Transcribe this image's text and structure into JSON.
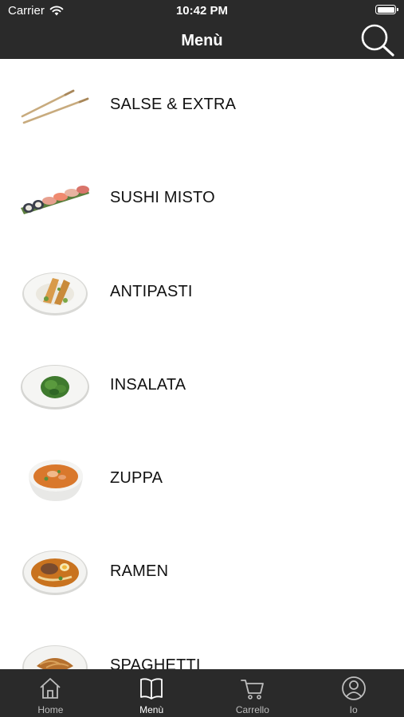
{
  "status_bar": {
    "carrier": "Carrier",
    "time": "10:42 PM"
  },
  "nav": {
    "title": "Menù",
    "search_icon": "search-icon"
  },
  "menu": {
    "items": [
      {
        "label": "SALSE & EXTRA",
        "image": "chopsticks"
      },
      {
        "label": "SUSHI MISTO",
        "image": "sushi-platter"
      },
      {
        "label": "ANTIPASTI",
        "image": "tempura-plate"
      },
      {
        "label": "INSALATA",
        "image": "seaweed-salad-bowl"
      },
      {
        "label": "ZUPPA",
        "image": "soup-bowl"
      },
      {
        "label": "RAMEN",
        "image": "ramen-bowl"
      },
      {
        "label": "SPAGHETTI",
        "image": "noodle-plate"
      }
    ]
  },
  "tabbar": {
    "tabs": [
      {
        "label": "Home",
        "icon": "home-icon",
        "active": false
      },
      {
        "label": "Menù",
        "icon": "book-icon",
        "active": true
      },
      {
        "label": "Carrello",
        "icon": "cart-icon",
        "active": false
      },
      {
        "label": "Io",
        "icon": "user-icon",
        "active": false
      }
    ]
  },
  "colors": {
    "bar_background": "#2a2a2a",
    "bar_text": "#ffffff",
    "inactive_tab_text": "#bdbdbd",
    "list_text": "#111111",
    "list_background": "#ffffff"
  }
}
